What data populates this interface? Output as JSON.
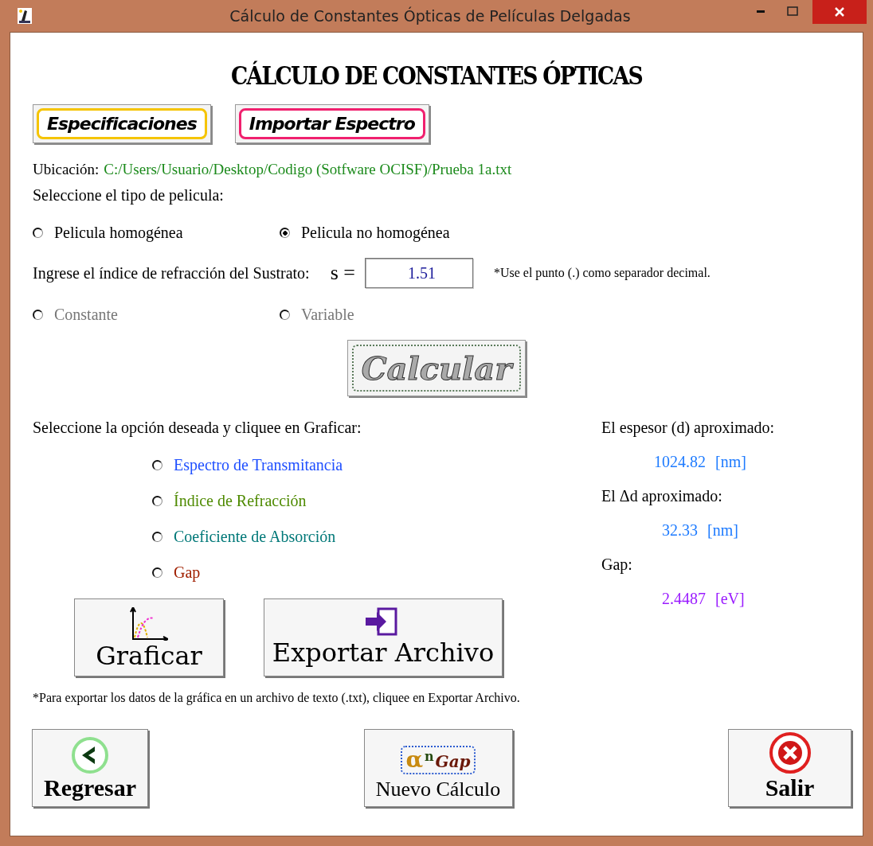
{
  "window": {
    "title": "Cálculo de Constantes Ópticas de Películas Delgadas"
  },
  "heading": "CÁLCULO DE CONSTANTES ÓPTICAS",
  "top_buttons": [
    {
      "label": "Especificaciones",
      "color": "#f5c400"
    },
    {
      "label": "Importar Espectro",
      "color": "#f0206e"
    }
  ],
  "location": {
    "label": "Ubicación:",
    "path": "C:/Users/Usuario/Desktop/Codigo (Sotfware OCISF)/Prueba 1a.txt"
  },
  "film_type": {
    "prompt": "Seleccione el tipo de pelicula:",
    "options": [
      {
        "label": "Pelicula homogénea",
        "selected": false
      },
      {
        "label": "Pelicula no homogénea",
        "selected": true
      }
    ]
  },
  "substrate": {
    "label": "Ingrese el índice de refracción del Sustrato:",
    "symbol": "s =",
    "value": "1.51",
    "note": "*Use el punto (.) como separador decimal."
  },
  "substrate_mode": {
    "disabled": true,
    "options": [
      {
        "label": "Constante",
        "selected": false
      },
      {
        "label": "Variable",
        "selected": false
      }
    ]
  },
  "calculate_button": {
    "label": "Calcular",
    "disabled": true
  },
  "plot_options": {
    "prompt": "Seleccione la opción deseada y cliquee en Graficar:",
    "options": [
      {
        "label": "Espectro de Transmitancia",
        "color": "#1f4fff",
        "selected": false
      },
      {
        "label": "Índice de Refracción",
        "color": "#4e8a00",
        "selected": false
      },
      {
        "label": "Coeficiente de Absorción",
        "color": "#007878",
        "selected": false
      },
      {
        "label": "Gap",
        "color": "#a02000",
        "selected": false
      }
    ]
  },
  "results": [
    {
      "label": "El espesor (d) aproximado:",
      "value": "1024.82",
      "unit": "[nm]",
      "color": "#1e7bff"
    },
    {
      "label": "El Δd aproximado:",
      "value": "32.33",
      "unit": "[nm]",
      "color": "#1e7bff"
    },
    {
      "label": "Gap:",
      "value": "2.4487",
      "unit": "[eV]",
      "color": "#9a1bff"
    }
  ],
  "plot_button": {
    "label": "Graficar"
  },
  "export_button": {
    "label": "Exportar Archivo"
  },
  "export_note": "*Para exportar los datos de la gráfica en un archivo de texto (.txt), cliquee en Exportar Archivo.",
  "bottom_buttons": [
    {
      "label": "Regresar",
      "kind": "back"
    },
    {
      "label": "Nuevo Cálculo",
      "kind": "new",
      "glyphs": [
        "α",
        "n",
        "Gap"
      ]
    },
    {
      "label": "Salir",
      "kind": "exit"
    }
  ]
}
